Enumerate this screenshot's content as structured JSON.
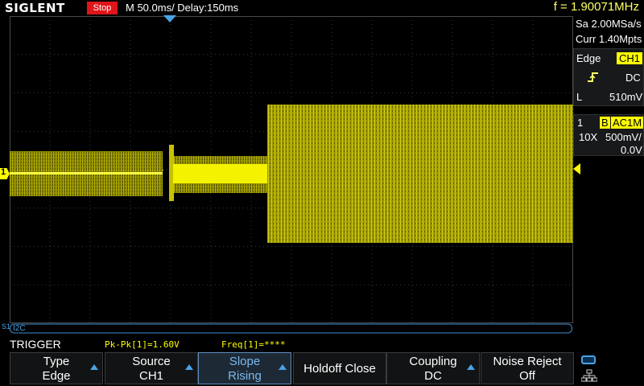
{
  "header": {
    "logo": "SIGLENT",
    "run_state": "Stop",
    "timebase": "M 50.0ms/ Delay:150ms",
    "frequency": "f = 1.90071MHz"
  },
  "acquisition": {
    "sample_rate": "Sa 2.00MSa/s",
    "memory_depth": "Curr 1.40Mpts"
  },
  "trigger_panel": {
    "type_label": "Edge",
    "source_badge": "CH1",
    "coupling": "DC",
    "level_prefix": "L",
    "level": "510mV"
  },
  "channel_panel": {
    "number": "1",
    "bandwidth_flag": "B",
    "coupling_badge": "AC1M",
    "probe": "10X",
    "scale": "500mV/",
    "offset": "0.0V"
  },
  "waveform": {
    "channel_marker": "1",
    "trace_color": "#ffff00",
    "band_color": "#a8a400",
    "bus_label": "I2C",
    "bus_marker": "S1"
  },
  "status": {
    "menu_title": "TRIGGER",
    "measurements": [
      "Pk-Pk[1]=1.60V",
      "Freq[1]=****"
    ]
  },
  "softkeys": [
    {
      "line1": "Type",
      "line2": "Edge",
      "arrow": true
    },
    {
      "line1": "Source",
      "line2": "CH1",
      "arrow": true
    },
    {
      "line1": "Slope",
      "line2": "Rising",
      "arrow": true
    },
    {
      "line1": "Holdoff Close",
      "line2": "",
      "arrow": false
    },
    {
      "line1": "Coupling",
      "line2": "DC",
      "arrow": true
    },
    {
      "line1": "Noise Reject",
      "line2": "Off",
      "arrow": false
    }
  ],
  "colors": {
    "accent_blue": "#49a3e8",
    "stop_red": "#e0151a",
    "yellow": "#ffff00"
  }
}
